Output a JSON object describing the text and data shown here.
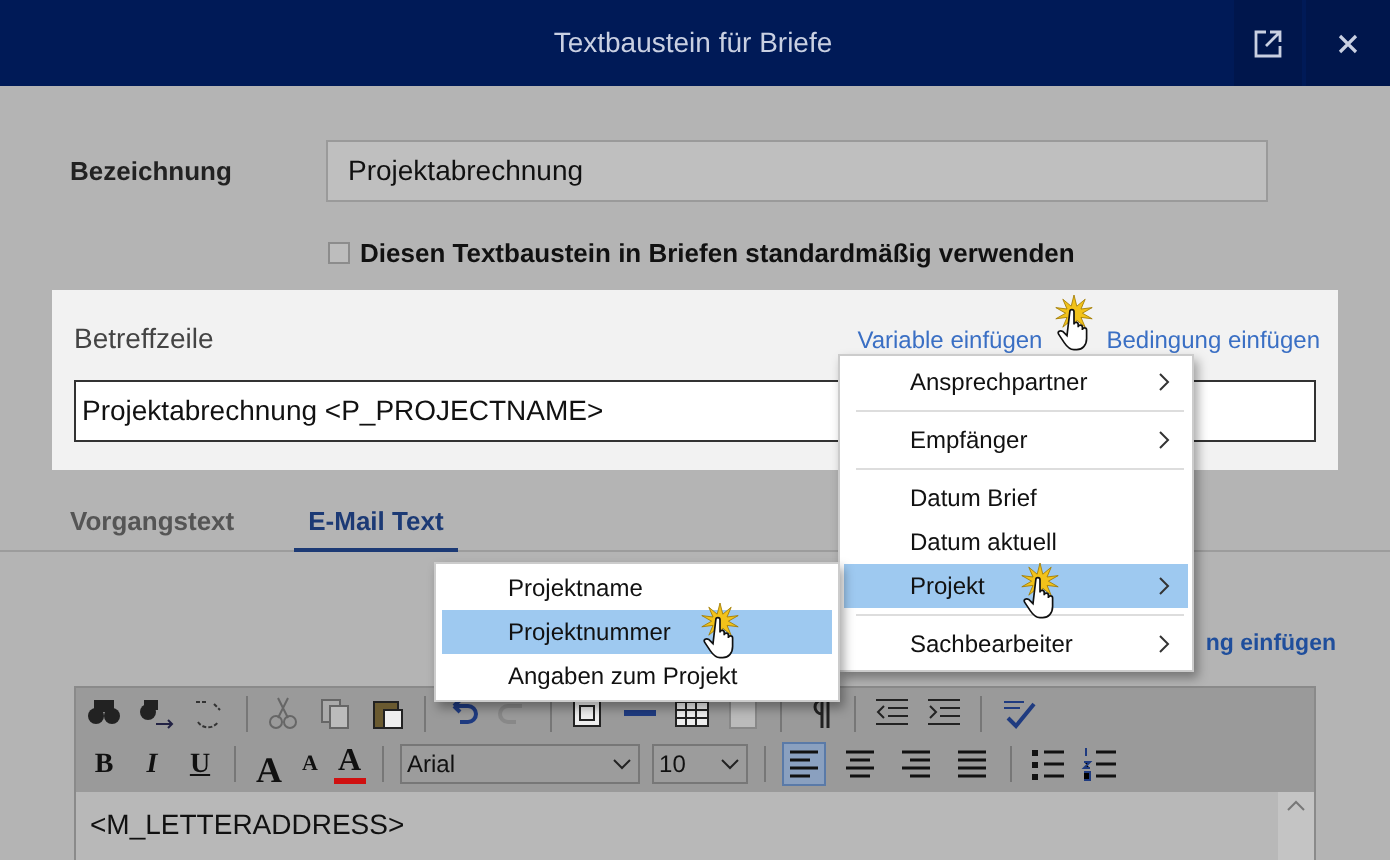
{
  "window": {
    "title": "Textbaustein für Briefe"
  },
  "name_field": {
    "label": "Bezeichnung",
    "value": "Projektabrechnung"
  },
  "default_checkbox": {
    "label": "Diesen Textbaustein in Briefen standardmäßig verwenden",
    "checked": false
  },
  "subject": {
    "label": "Betreffzeile",
    "links": [
      "Variable einfügen",
      "Bedingung einfügen"
    ],
    "value": "Projektabrechnung <P_PROJECTNAME>"
  },
  "tabs": [
    {
      "label": "Vorgangstext",
      "selected": false
    },
    {
      "label": "E-Mail Text",
      "selected": true
    }
  ],
  "email_link": "ng einfügen",
  "variable_menu": [
    {
      "kind": "submenu",
      "label": "Ansprechpartner",
      "selected": false
    },
    {
      "kind": "separator"
    },
    {
      "kind": "submenu",
      "label": "Empfänger",
      "selected": false
    },
    {
      "kind": "separator"
    },
    {
      "kind": "item",
      "label": "Datum Brief",
      "selected": false
    },
    {
      "kind": "item",
      "label": "Datum aktuell",
      "selected": false
    },
    {
      "kind": "submenu",
      "label": "Projekt",
      "selected": true
    },
    {
      "kind": "separator"
    },
    {
      "kind": "submenu",
      "label": "Sachbearbeiter",
      "selected": false
    }
  ],
  "project_submenu": [
    {
      "label": "Projektname",
      "selected": false
    },
    {
      "label": "Projektnummer",
      "selected": true
    },
    {
      "label": "Angaben zum Projekt",
      "selected": false
    }
  ],
  "editor": {
    "format_buttons": [
      {
        "label": "B"
      },
      {
        "label": "I"
      },
      {
        "label": "U"
      }
    ],
    "size_buttons": [
      {
        "label": "A"
      },
      {
        "label": "A"
      },
      {
        "label": "A"
      }
    ],
    "font": "Arial",
    "font_size": "10",
    "alignment": [
      {
        "kind": "left",
        "selected": true
      },
      {
        "kind": "center",
        "selected": false
      },
      {
        "kind": "right",
        "selected": false
      },
      {
        "kind": "justify",
        "selected": false
      }
    ],
    "content": "<M_LETTERADDRESS>"
  }
}
